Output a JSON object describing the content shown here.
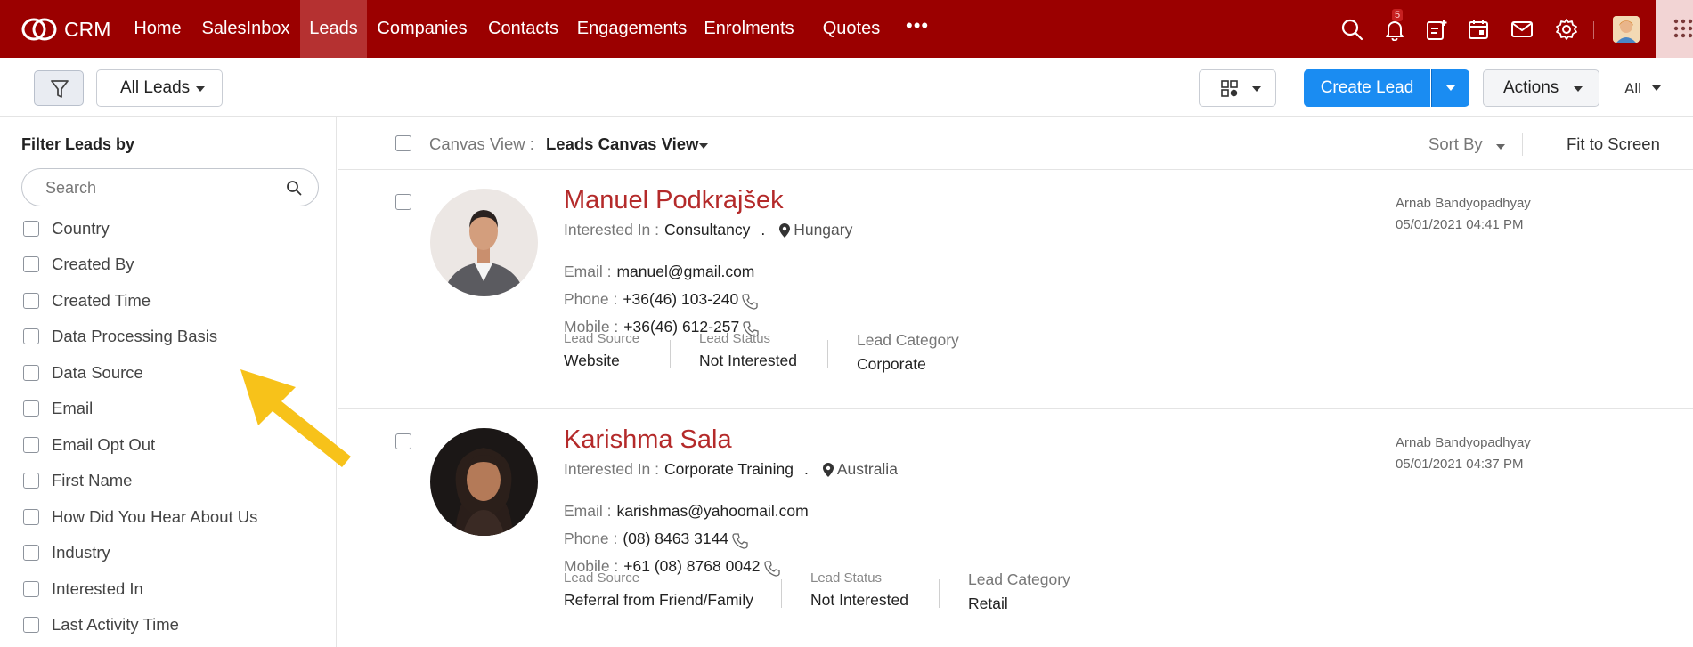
{
  "nav": {
    "brand": "CRM",
    "items": [
      {
        "label": "Home",
        "active": false
      },
      {
        "label": "SalesInbox",
        "active": false
      },
      {
        "label": "Leads",
        "active": true
      },
      {
        "label": "Companies",
        "active": false
      },
      {
        "label": "Contacts",
        "active": false
      },
      {
        "label": "Engagements",
        "active": false
      },
      {
        "label": "Enrolments",
        "active": false
      },
      {
        "label": "Quotes",
        "active": false
      }
    ],
    "more": "•••",
    "notification_count": "5",
    "icons": [
      "search-icon",
      "bell-icon",
      "new-record-icon",
      "calendar-icon",
      "mail-icon",
      "gear-icon",
      "avatar",
      "apps-grid-icon"
    ]
  },
  "toolbar": {
    "view_label": "All Leads",
    "create_label": "Create Lead",
    "actions_label": "Actions",
    "all_label": "All"
  },
  "sidebar": {
    "title": "Filter Leads by",
    "search_placeholder": "Search",
    "filters": [
      "Country",
      "Created By",
      "Created Time",
      "Data Processing Basis",
      "Data Source",
      "Email",
      "Email Opt Out",
      "First Name",
      "How Did You Hear About Us",
      "Industry",
      "Interested In",
      "Last Activity Time"
    ]
  },
  "canvas": {
    "label": "Canvas View :",
    "value": "Leads Canvas View",
    "sort_label": "Sort By",
    "fit_label": "Fit to Screen"
  },
  "labels": {
    "interested_in": "Interested In :",
    "email": "Email :",
    "phone": "Phone :",
    "mobile": "Mobile :",
    "lead_source": "Lead Source",
    "lead_status": "Lead Status",
    "lead_category": "Lead Category"
  },
  "leads": [
    {
      "name": "Manuel Podkrajšek",
      "interested_in": "Consultancy",
      "location": "Hungary",
      "email": "manuel@gmail.com",
      "phone": "+36(46) 103-240",
      "mobile": "+36(46) 612-257",
      "lead_source": "Website",
      "lead_status": "Not Interested",
      "lead_category": "Corporate",
      "owner": "Arnab Bandyopadhyay",
      "created": "05/01/2021 04:41 PM"
    },
    {
      "name": "Karishma Sala",
      "interested_in": "Corporate Training",
      "location": "Australia",
      "email": "karishmas@yahoomail.com",
      "phone": "(08) 8463 3144",
      "mobile": "+61 (08) 8768 0042",
      "lead_source": "Referral from Friend/Family",
      "lead_status": "Not Interested",
      "lead_category": "Retail",
      "owner": "Arnab Bandyopadhyay",
      "created": "05/01/2021 04:37 PM"
    }
  ],
  "colors": {
    "nav_bg": "#9b0000",
    "nav_active": "#b53131",
    "primary_button": "#1a8cf2",
    "lead_name": "#b42a2a",
    "annotation_arrow": "#f7c21a"
  }
}
